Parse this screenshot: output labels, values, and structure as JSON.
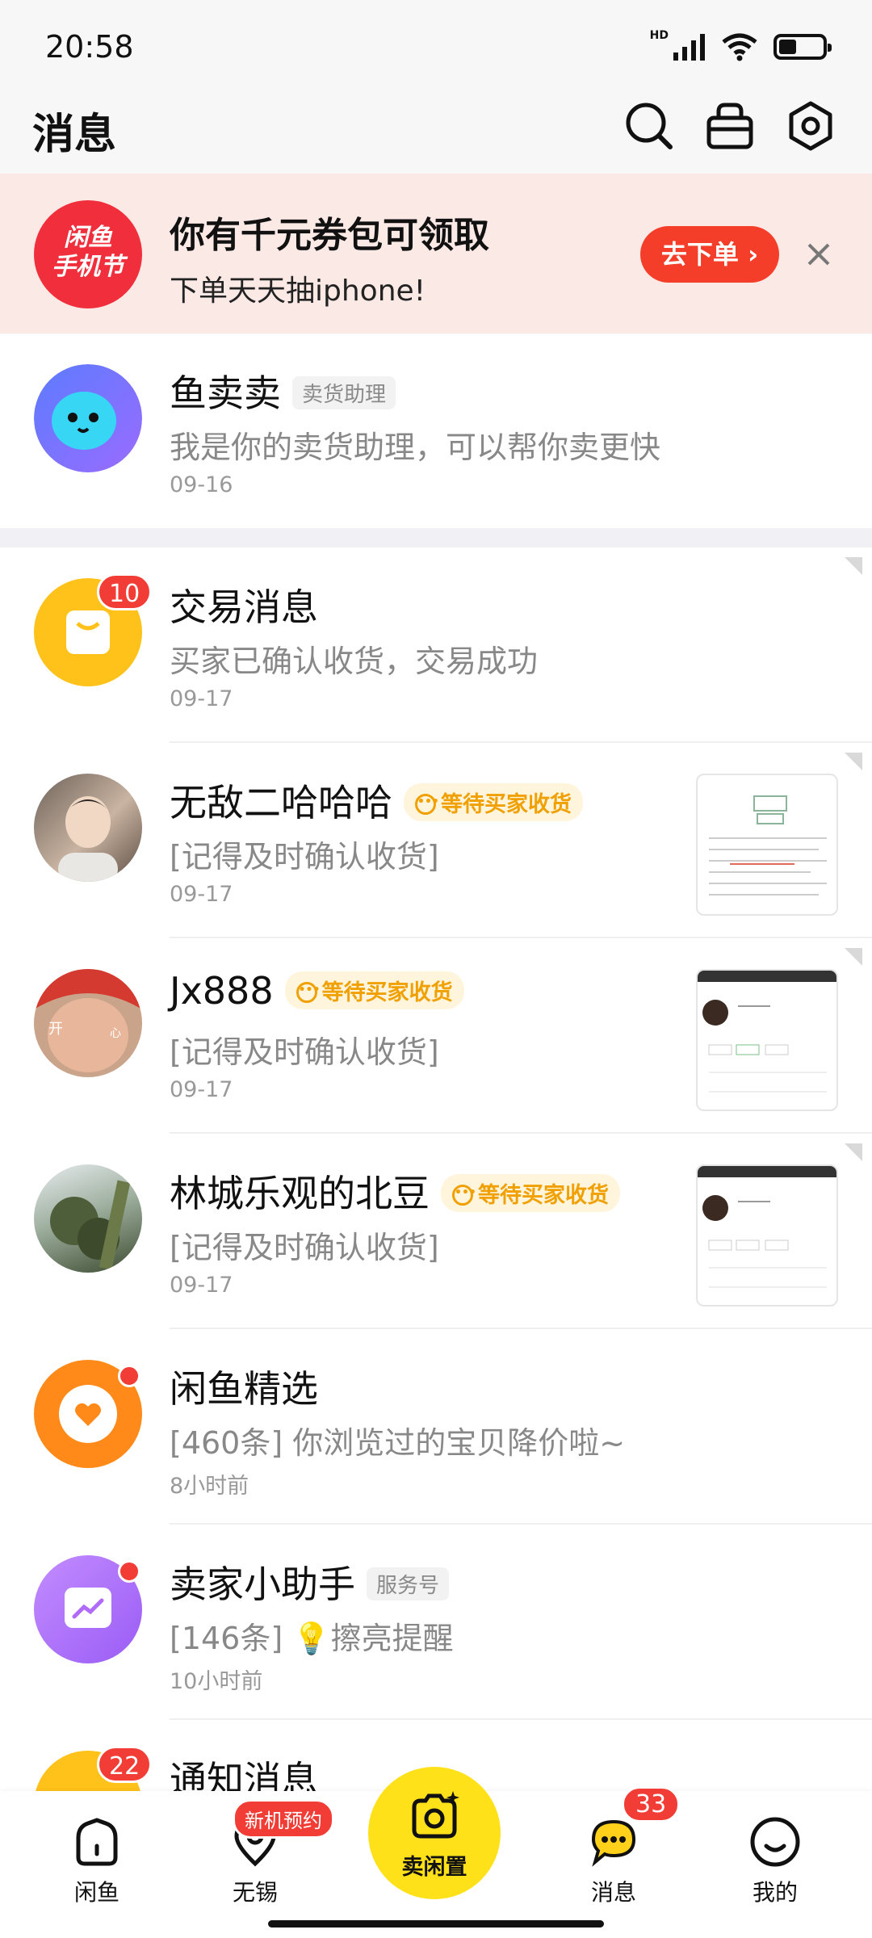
{
  "status_bar": {
    "time": "20:58",
    "network": "HD",
    "wifi_label": "6",
    "battery_level": 0.4
  },
  "header": {
    "title": "消息"
  },
  "promo": {
    "logo_line1": "闲鱼",
    "logo_line2": "手机节",
    "title": "你有千元券包可领取",
    "subtitle": "下单天天抽iphone!",
    "button": "去下单 ›"
  },
  "assistant": {
    "name": "鱼卖卖",
    "tag": "卖货助理",
    "message": "我是你的卖货助理，可以帮你卖更快",
    "date": "09-16"
  },
  "conversations": [
    {
      "title": "交易消息",
      "message": "买家已确认收货，交易成功",
      "date": "09-17",
      "badge": "10"
    },
    {
      "title": "无敌二哈哈哈",
      "status": "等待买家收货",
      "message": "[记得及时确认收货]",
      "date": "09-17"
    },
    {
      "title": "Jx888",
      "status": "等待买家收货",
      "message": "[记得及时确认收货]",
      "date": "09-17",
      "avatar_text_left": "开",
      "avatar_text_right": "心"
    },
    {
      "title": "林城乐观的北豆",
      "status": "等待买家收货",
      "message": "[记得及时确认收货]",
      "date": "09-17"
    },
    {
      "title": "闲鱼精选",
      "message": "[460条] 你浏览过的宝贝降价啦~",
      "date": "8小时前"
    },
    {
      "title": "卖家小助手",
      "tag": "服务号",
      "message": "[146条] 💡擦亮提醒",
      "date": "10小时前"
    },
    {
      "title": "通知消息",
      "badge": "22"
    }
  ],
  "bottom_nav": {
    "home": "闲鱼",
    "local": "无锡",
    "local_badge": "新机预约",
    "sell": "卖闲置",
    "messages": "消息",
    "messages_badge": "33",
    "me": "我的"
  },
  "colors": {
    "accent_yellow": "#ffe11a",
    "badge_red": "#f23c36",
    "status_orange": "#f0a000"
  }
}
